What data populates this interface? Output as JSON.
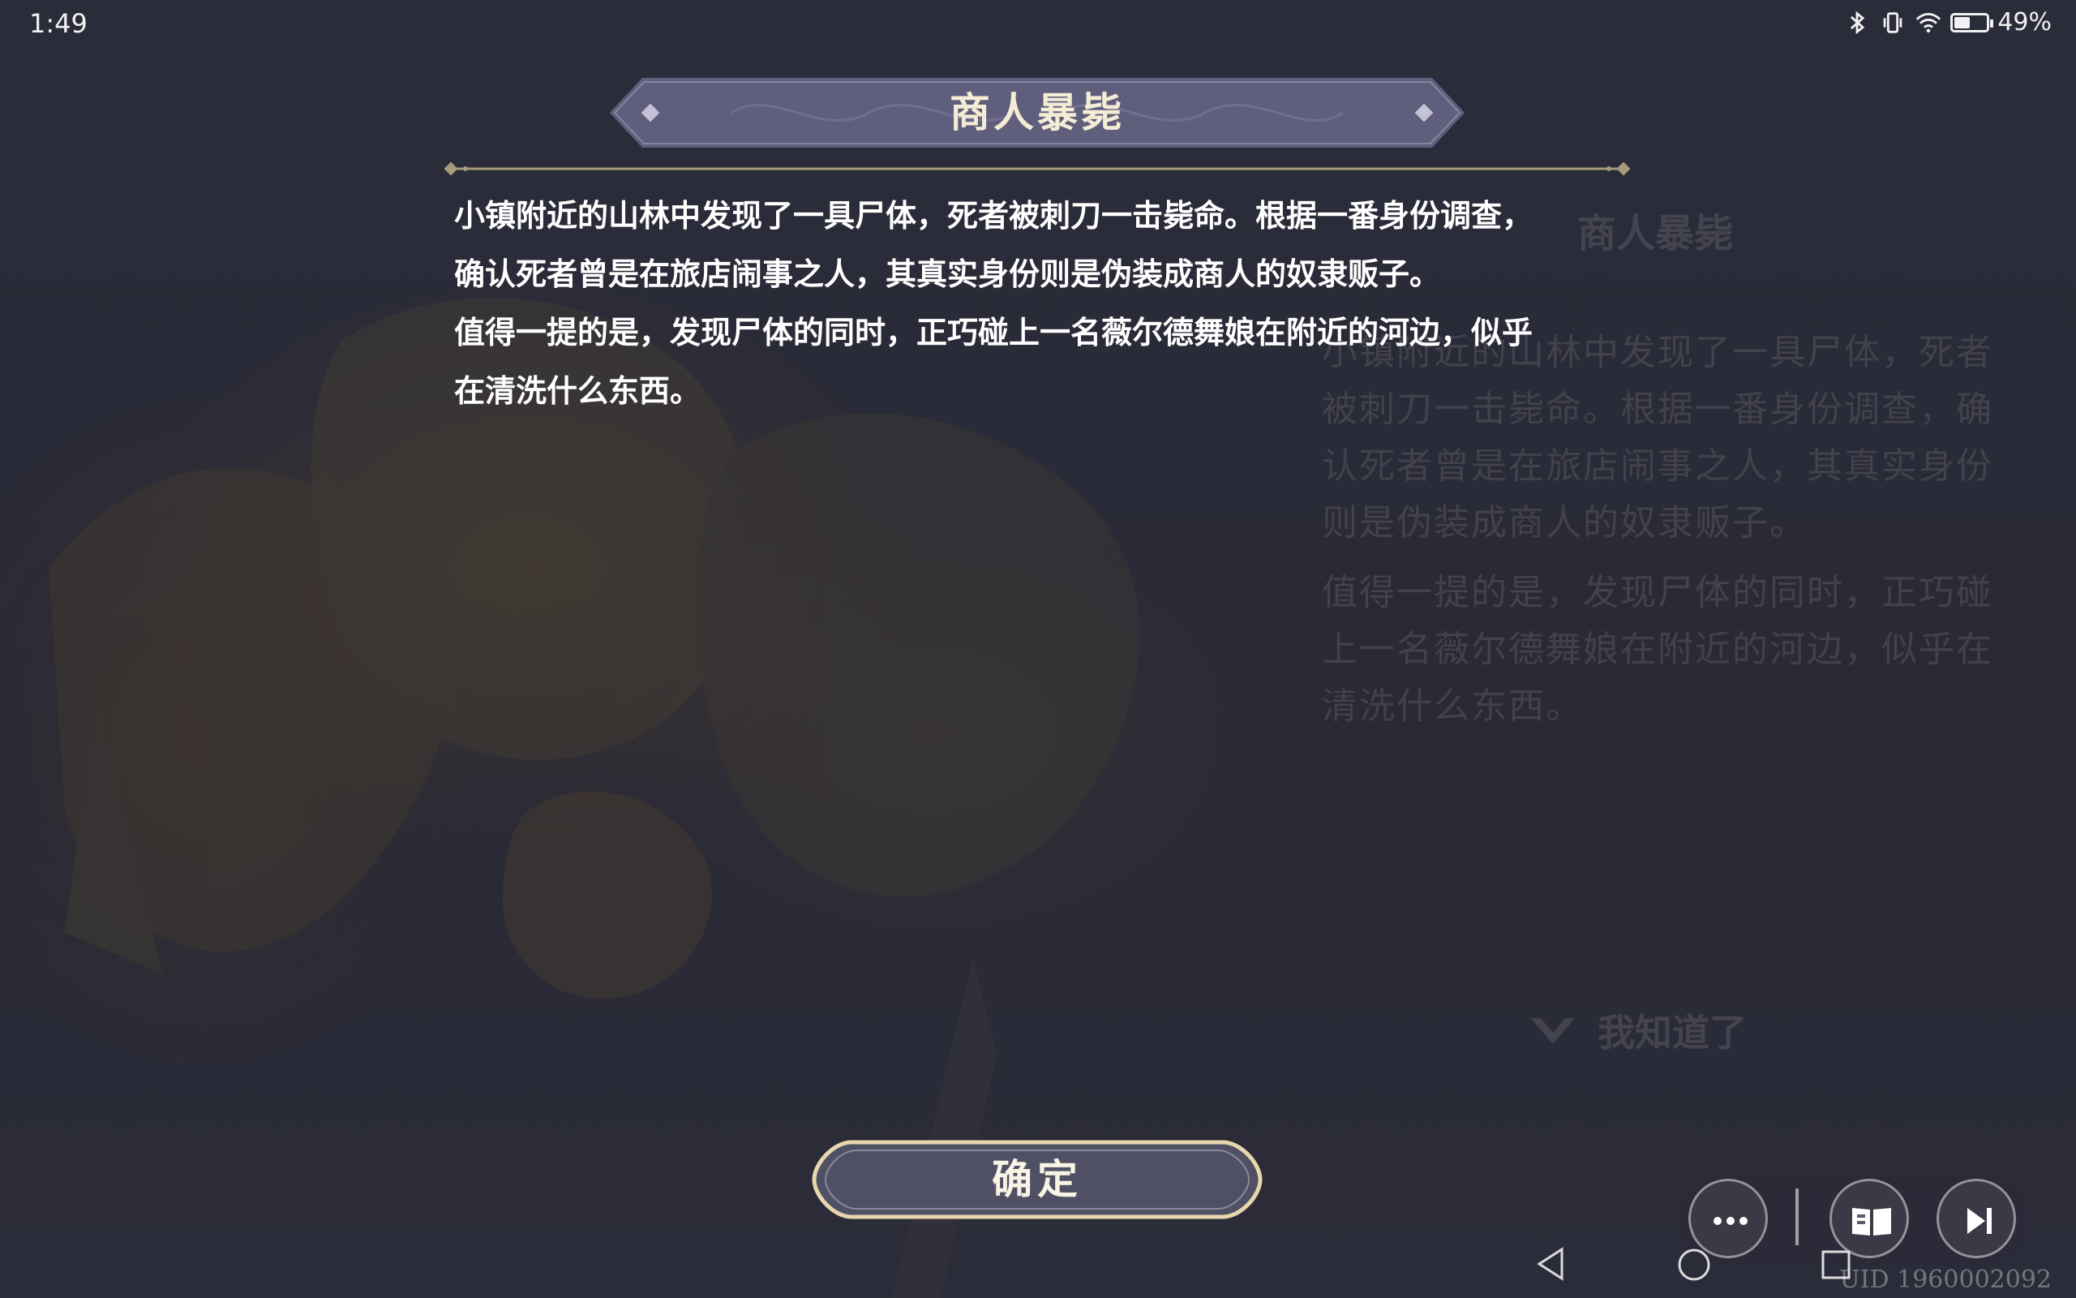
{
  "status_bar": {
    "time": "1:49",
    "battery_percent_text": "49%",
    "battery_level": 0.49,
    "icons": [
      "bluetooth-icon",
      "vibrate-icon",
      "wifi-icon",
      "battery-icon"
    ]
  },
  "dialog": {
    "title": "商人暴毙",
    "paragraphs": [
      "小镇附近的山林中发现了一具尸体，死者被刺刀一击毙命。根据一番身份调查，",
      "确认死者曾是在旅店闹事之人，其真实身份则是伪装成商人的奴隶贩子。",
      "值得一提的是，发现尸体的同时，正巧碰上一名薇尔德舞娘在附近的河边，似乎",
      "在清洗什么东西。"
    ],
    "confirm_label": "确定"
  },
  "background_panel": {
    "title": "商人暴毙",
    "lines_1": [
      "小镇附近的山林中发现了一具尸体，死者",
      "被刺刀一击毙命。根据一番身份调查，确",
      "认死者曾是在旅店闹事之人，其真实身份",
      "则是伪装成商人的奴隶贩子。"
    ],
    "lines_2": [
      "值得一提的是，发现尸体的同时，正巧碰",
      "上一名薇尔德舞娘在附近的河边，似乎在",
      "清洗什么东西。"
    ],
    "ack_label": "我知道了"
  },
  "controls": {
    "icons": [
      "more-icon",
      "book-icon",
      "skip-icon"
    ]
  },
  "nav": {
    "icons": [
      "back-icon",
      "home-icon",
      "recents-icon"
    ]
  },
  "uid": "UID 1960002092",
  "colors": {
    "background": "#2a2b38",
    "banner": "#5f5f7d",
    "accent_gold": "#d9c9a0",
    "button_fill": "#4f5064"
  }
}
